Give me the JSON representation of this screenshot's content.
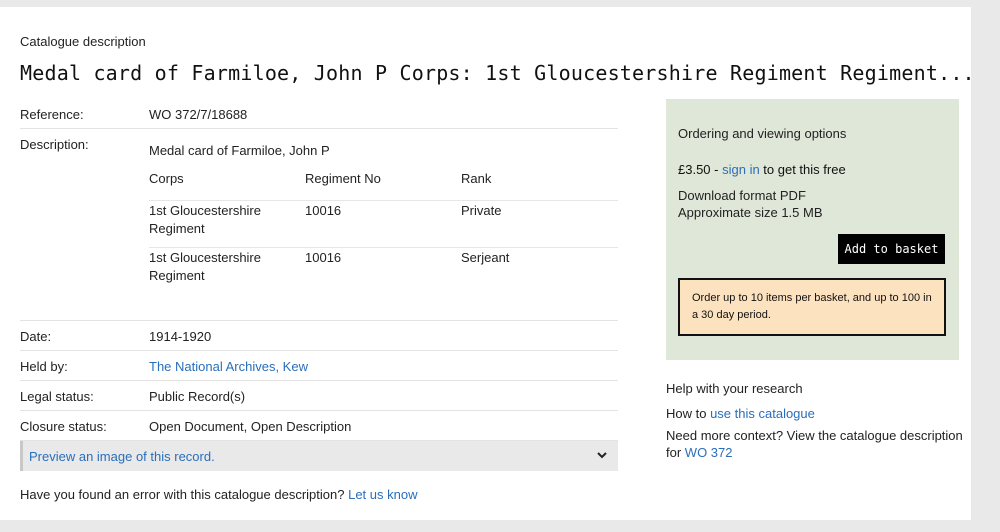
{
  "header": {
    "section_label": "Catalogue description",
    "title": "Medal card of Farmiloe, John P Corps: 1st Gloucestershire Regiment Regiment..."
  },
  "details": {
    "reference": {
      "label": "Reference:",
      "value": "WO 372/7/18688"
    },
    "description": {
      "label": "Description:",
      "text": "Medal card of Farmiloe, John P",
      "table": {
        "headers": [
          "Corps",
          "Regiment No",
          "Rank"
        ],
        "rows": [
          [
            "1st Gloucestershire Regiment",
            "10016",
            "Private"
          ],
          [
            "1st Gloucestershire Regiment",
            "10016",
            "Serjeant"
          ]
        ]
      }
    },
    "date": {
      "label": "Date:",
      "value": "1914-1920"
    },
    "held_by": {
      "label": "Held by:",
      "value": "The National Archives, Kew"
    },
    "legal_status": {
      "label": "Legal status:",
      "value": "Public Record(s)"
    },
    "closure_status": {
      "label": "Closure status:",
      "value": "Open Document, Open Description"
    }
  },
  "preview": {
    "label": "Preview an image of this record."
  },
  "error_report": {
    "text": "Have you found an error with this catalogue description?",
    "link": "Let us know"
  },
  "ordering": {
    "title": "Ordering and viewing options",
    "price": "£3.50",
    "price_sep": " - ",
    "sign_in_link": "sign in",
    "price_suffix": " to get this free",
    "format": "Download format PDF",
    "size": "Approximate size 1.5 MB",
    "add_button": "Add to basket",
    "notice": "Order up to 10 items per basket, and up to 100 in a 30 day period."
  },
  "help": {
    "title": "Help with your research",
    "how_prefix": "How to ",
    "how_link": "use this catalogue",
    "context_text": "Need more context? View the catalogue description for ",
    "context_link": "WO 372"
  },
  "colors": {
    "link": "#2a6ebb",
    "order_box_bg": "#dfe7d8",
    "notice_bg": "#fde2c0",
    "button_bg": "#000000",
    "page_bg": "#e9e9e9"
  },
  "icons": {
    "preview_toggle": "chevron-down-icon"
  }
}
